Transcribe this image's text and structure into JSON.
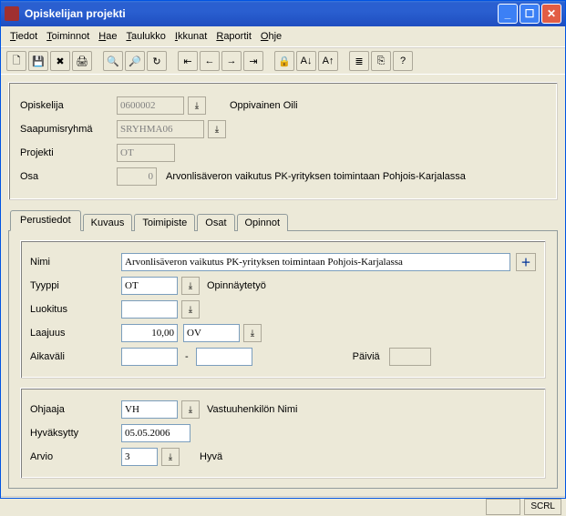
{
  "window": {
    "title": "Opiskelijan projekti"
  },
  "menu": {
    "tiedot": "Tiedot",
    "toiminnot": "Toiminnot",
    "hae": "Hae",
    "taulukko": "Taulukko",
    "ikkunat": "Ikkunat",
    "raportit": "Raportit",
    "ohje": "Ohje"
  },
  "header": {
    "opiskelija_lbl": "Opiskelija",
    "opiskelija_val": "0600002",
    "opiskelija_name": "Oppivainen Oili",
    "saapumisryhma_lbl": "Saapumisryhmä",
    "saapumisryhma_val": "SRYHMA06",
    "projekti_lbl": "Projekti",
    "projekti_val": "OT",
    "osa_lbl": "Osa",
    "osa_val": "0",
    "osa_desc": "Arvonlisäveron vaikutus PK-yrityksen toimintaan Pohjois-Karjalassa"
  },
  "tabs": {
    "perustiedot": "Perustiedot",
    "kuvaus": "Kuvaus",
    "toimipiste": "Toimipiste",
    "osat": "Osat",
    "opinnot": "Opinnot"
  },
  "nimi_lbl": "Nimi",
  "nimi_val": "Arvonlisäveron vaikutus PK-yrityksen toimintaan Pohjois-Karjalassa",
  "tyyppi_lbl": "Tyyppi",
  "tyyppi_val": "OT",
  "tyyppi_desc": "Opinnäytetyö",
  "luokitus_lbl": "Luokitus",
  "luokitus_val": "",
  "laajuus_lbl": "Laajuus",
  "laajuus_val": "10,00",
  "laajuus_unit": "OV",
  "aikavali_lbl": "Aikaväli",
  "aikavali_from": "",
  "aikavali_sep": "-",
  "aikavali_to": "",
  "paivia_lbl": "Päiviä",
  "paivia_val": "",
  "ohjaaja_lbl": "Ohjaaja",
  "ohjaaja_val": "VH",
  "ohjaaja_desc": "Vastuuhenkilön Nimi",
  "hyvaksytty_lbl": "Hyväksytty",
  "hyvaksytty_val": "05.05.2006",
  "arvio_lbl": "Arvio",
  "arvio_val": "3",
  "arvio_desc": "Hyvä",
  "status": {
    "scrl": "SCRL"
  }
}
